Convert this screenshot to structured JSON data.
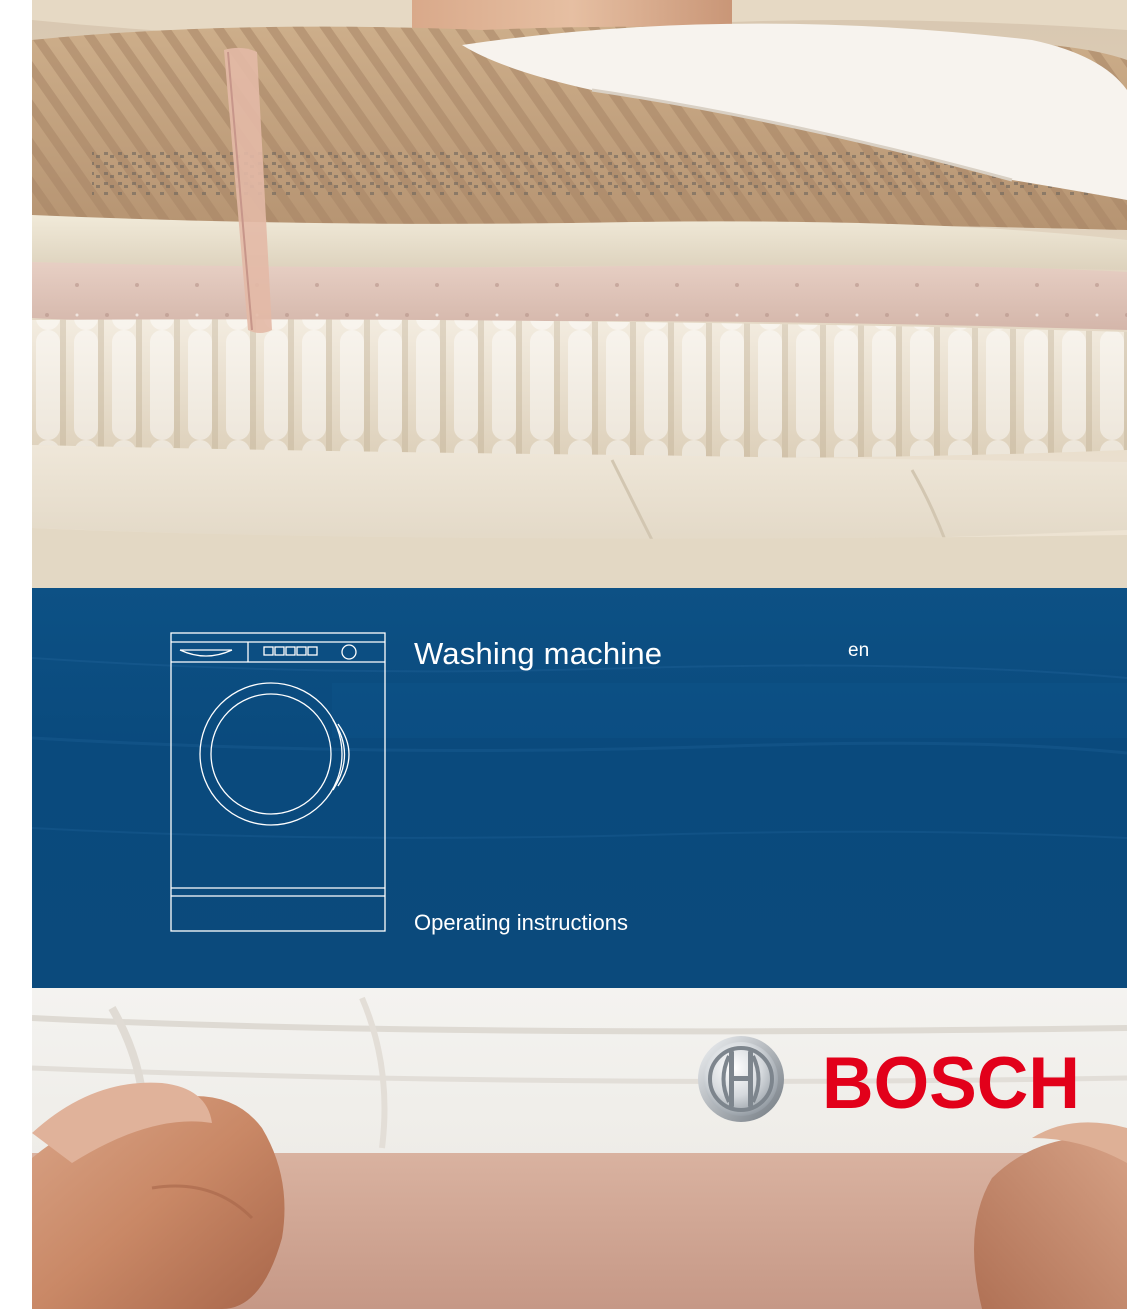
{
  "cover": {
    "product_title": "Washing machine",
    "language_code": "en",
    "document_type": "Operating instructions"
  },
  "brand": {
    "name": "BOSCH",
    "wordmark_color": "#e2001a"
  },
  "colors": {
    "band": "#0b4a7c",
    "text_on_band": "#ffffff"
  },
  "images": {
    "top_photo": "stack of folded linens and knitwear",
    "bottom_photo": "hands holding white linens",
    "line_drawing": "front-loading washing machine outline"
  }
}
